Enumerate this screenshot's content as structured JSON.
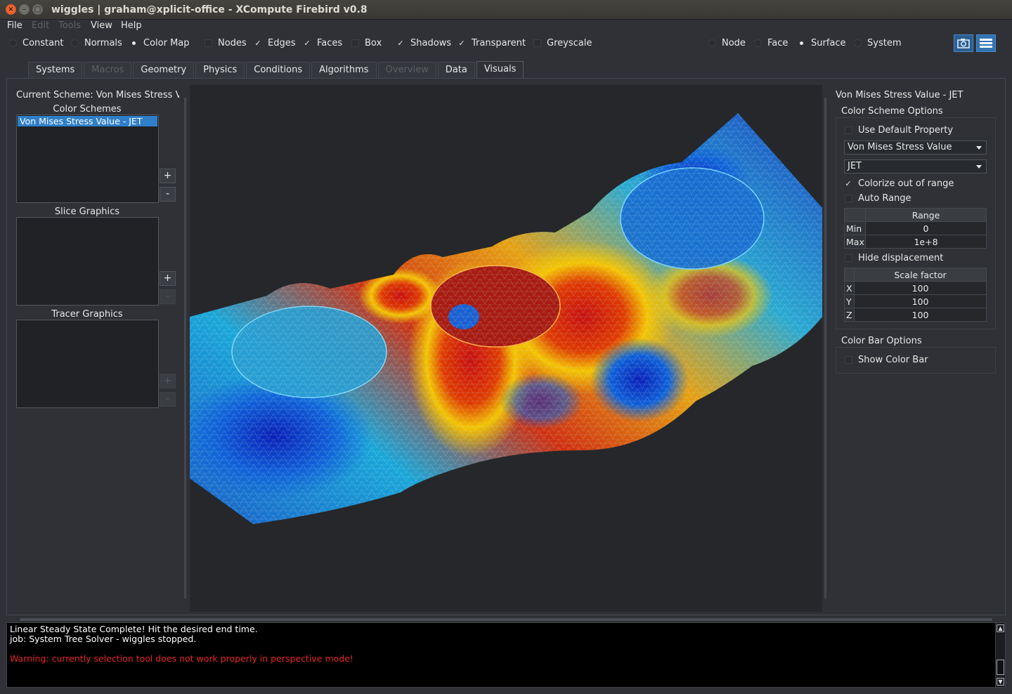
{
  "window": {
    "title": "wiggles | graham@xplicit-office - XCompute Firebird v0.8"
  },
  "menu": {
    "file": "File",
    "edit": "Edit",
    "tools": "Tools",
    "view": "View",
    "help": "Help"
  },
  "toolbar": {
    "constant": "Constant",
    "normals": "Normals",
    "color_map": "Color Map",
    "nodes": "Nodes",
    "edges": "Edges",
    "faces": "Faces",
    "box": "Box",
    "shadows": "Shadows",
    "transparent": "Transparent",
    "greyscale": "Greyscale",
    "node": "Node",
    "face": "Face",
    "surface": "Surface",
    "system": "System"
  },
  "tabs": {
    "systems": "Systems",
    "macros": "Macros",
    "geometry": "Geometry",
    "physics": "Physics",
    "conditions": "Conditions",
    "algorithms": "Algorithms",
    "overview": "Overview",
    "data": "Data",
    "visuals": "Visuals"
  },
  "left": {
    "current_scheme": "Current Scheme: Von Mises Stress Val",
    "color_schemes": "Color Schemes",
    "selected_scheme": "Von Mises Stress Value - JET",
    "slice_graphics": "Slice Graphics",
    "tracer_graphics": "Tracer Graphics",
    "plus": "+",
    "minus": "-"
  },
  "right": {
    "title": "Von Mises Stress Value - JET",
    "color_scheme_options": "Color Scheme Options",
    "use_default_property": "Use Default Property",
    "property_combo": "Von Mises Stress Value",
    "colormap_combo": "JET",
    "colorize_out_of_range": "Colorize out of range",
    "auto_range": "Auto Range",
    "range_header": "Range",
    "min_label": "Min",
    "min_value": "0",
    "max_label": "Max",
    "max_value": "1e+8",
    "hide_displacement": "Hide displacement",
    "scale_header": "Scale factor",
    "x_label": "X",
    "x_value": "100",
    "y_label": "Y",
    "y_value": "100",
    "z_label": "Z",
    "z_value": "100",
    "color_bar_options": "Color Bar Options",
    "show_color_bar": "Show Color Bar"
  },
  "console": {
    "line1": "Linear Steady State Complete! Hit the desired end time.",
    "line2": "job: System Tree Solver - wiggles stopped.",
    "warning": "Warning: currently selection tool does not work properly in perspective mode!"
  },
  "colors": {
    "selection": "#2f7fc8",
    "warning": "#e82525",
    "camera_button": "#2b5f91"
  }
}
